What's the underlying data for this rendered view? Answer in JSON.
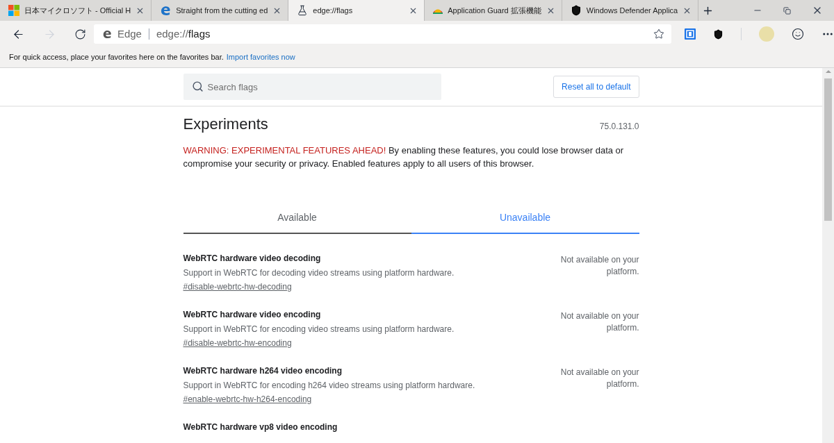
{
  "tabs": [
    {
      "title": "日本マイクロソフト - Official H",
      "kind": "windows",
      "selected": false
    },
    {
      "title": "Straight from the cutting ed",
      "kind": "edge",
      "selected": false
    },
    {
      "title": "edge://flags",
      "kind": "flask",
      "selected": true
    },
    {
      "title": "Application Guard 拡張機能",
      "kind": "chrome",
      "selected": false
    },
    {
      "title": "Windows Defender Applica",
      "kind": "shield",
      "selected": false
    }
  ],
  "address_bar": {
    "site": "Edge",
    "url_prefix": "edge://",
    "url_path": "flags"
  },
  "favorites_bar": {
    "message": "For quick access, place your favorites here on the favorites bar.",
    "link": "Import favorites now"
  },
  "search": {
    "placeholder": "Search flags"
  },
  "reset_button": "Reset all to default",
  "title": "Experiments",
  "version": "75.0.131.0",
  "warning": {
    "label": "WARNING: EXPERIMENTAL FEATURES AHEAD!",
    "text": "By enabling these features, you could lose browser data or compromise your security or privacy. Enabled features apply to all users of this browser."
  },
  "flag_tabs": [
    {
      "label": "Available",
      "selected": false
    },
    {
      "label": "Unavailable",
      "selected": true
    }
  ],
  "flags": [
    {
      "name": "WebRTC hardware video decoding",
      "description": "Support in WebRTC for decoding video streams using platform hardware.",
      "link": "#disable-webrtc-hw-decoding",
      "status": "Not available on your platform."
    },
    {
      "name": "WebRTC hardware video encoding",
      "description": "Support in WebRTC for encoding video streams using platform hardware.",
      "link": "#disable-webrtc-hw-encoding",
      "status": "Not available on your platform."
    },
    {
      "name": "WebRTC hardware h264 video encoding",
      "description": "Support in WebRTC for encoding h264 video streams using platform hardware.",
      "link": "#enable-webrtc-hw-h264-encoding",
      "status": "Not available on your platform."
    },
    {
      "name": "WebRTC hardware vp8 video encoding"
    }
  ]
}
